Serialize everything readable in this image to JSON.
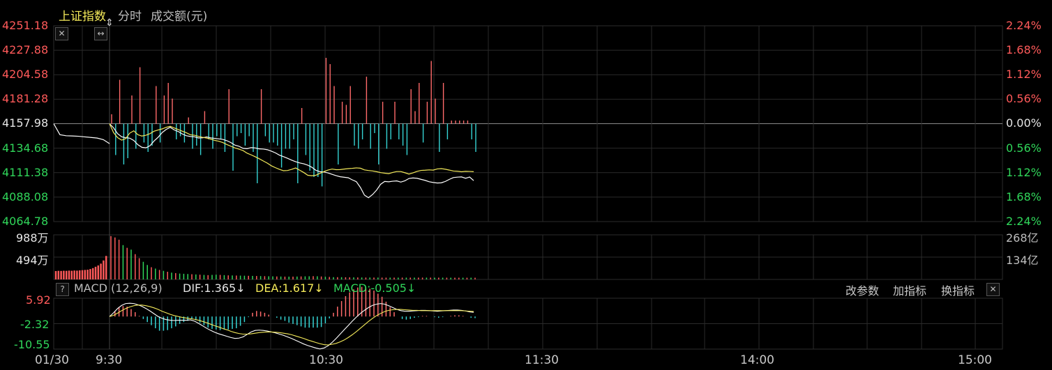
{
  "header": {
    "index_name": "上证指数",
    "mode_label": "分时",
    "volume_unit_label": "成交额(元)"
  },
  "icons": {
    "close_icon": "close-icon",
    "resize_icon": "horizontal-resize-icon",
    "help_icon": "help-icon"
  },
  "colors": {
    "up": "#ff5a5a",
    "down": "#30d65a",
    "price_line": "#ffffff",
    "avg_line": "#f4ea5a",
    "pos_bar": "#ff6a6a",
    "neg_bar": "#35d4d4",
    "grid": "#2a2a2a",
    "neutral": "#bdbdbd"
  },
  "price_axis": {
    "left_labels": [
      "4251.18",
      "4227.88",
      "4204.58",
      "4181.28",
      "4157.98",
      "4134.68",
      "4111.38",
      "4088.08",
      "4064.78"
    ],
    "right_labels": [
      "2.24%",
      "1.68%",
      "1.12%",
      "0.56%",
      "0.00%",
      "0.56%",
      "1.12%",
      "1.68%",
      "2.24%"
    ]
  },
  "volume_axis": {
    "left_labels": [
      "988万",
      "494万"
    ],
    "right_labels": [
      "268亿",
      "134亿"
    ]
  },
  "macd_panel": {
    "title": "MACD (12,26,9)",
    "dif": "DIF:1.365↓",
    "dea": "DEA:1.617↓",
    "macd": "MACD:-0.505↓",
    "axis_labels": [
      "5.92",
      "-2.32",
      "-10.55"
    ],
    "tools": [
      "改参数",
      "加指标",
      "换指标"
    ]
  },
  "time_axis": {
    "labels": [
      "01/30",
      "9:30",
      "10:30",
      "11:30",
      "14:00",
      "15:00"
    ]
  },
  "chart_data": {
    "type": "line",
    "prev_close": 4157.98,
    "ylim": [
      4064.78,
      4251.18
    ],
    "pct_range": [
      -2.24,
      2.24
    ],
    "volume_ylim": [
      0,
      988
    ],
    "macd_ylim": [
      -10.55,
      5.92
    ],
    "x_start_label": "9:30",
    "x_ticks": [
      "9:30",
      "10:30",
      "11:30",
      "14:00",
      "15:00"
    ],
    "series": [
      {
        "key": "price",
        "values": [
          4157.98,
          4154.0,
          4148.5,
          4145.5,
          4144.6,
          4144.2,
          4142.0,
          4138.0,
          4135.5,
          4135.0,
          4137.0,
          4141.5,
          4145.0,
          4149.5,
          4152.5,
          4154.5,
          4152.0,
          4150.5,
          4148.2,
          4146.5,
          4145.8,
          4145.5,
          4144.4,
          4144.5,
          4145.4,
          4144.5,
          4144.0,
          4143.5,
          4143.0,
          4141.8,
          4140.0,
          4137.5,
          4136.5,
          4134.5,
          4134.2,
          4135.2,
          4134.9,
          4134.0,
          4133.8,
          4133.2,
          4131.8,
          4130.2,
          4128.0,
          4126.6,
          4125.0,
          4123.3,
          4121.8,
          4120.6,
          4119.8,
          4118.5,
          4116.5,
          4113.6,
          4112.3,
          4112.0,
          4111.1,
          4109.8,
          4108.5,
          4107.5,
          4107.0,
          4106.5,
          4104.5,
          4102.8,
          4097.3,
          4090.0,
          4087.5,
          4090.5,
          4094.7,
          4100.3,
          4103.0,
          4102.7,
          4103.2,
          4103.5,
          4102.4,
          4103.6,
          4105.8,
          4106.3,
          4106.0,
          4105.0,
          4104.0,
          4102.7,
          4102.0,
          4101.5,
          4101.7,
          4103.0,
          4105.0,
          4106.7,
          4107.1,
          4107.3,
          4106.0,
          4107.2,
          4103.8
        ]
      },
      {
        "key": "avg_price",
        "values": [
          4157.98,
          4149.5,
          4144.7,
          4142.3,
          4143.8,
          4149.0,
          4151.2,
          4147.5,
          4146.2,
          4147.0,
          4148.5,
          4150.8,
          4152.0,
          4153.0,
          4154.5,
          4155.5,
          4153.9,
          4152.4,
          4150.8,
          4149.3,
          4147.4,
          4147.0,
          4145.9,
          4145.0,
          4144.3,
          4143.3,
          4142.1,
          4141.3,
          4140.0,
          4138.1,
          4136.5,
          4134.9,
          4133.7,
          4132.4,
          4129.9,
          4128.3,
          4126.5,
          4124.6,
          4122.5,
          4120.4,
          4117.9,
          4116.1,
          4114.5,
          4113.2,
          4113.4,
          4114.5,
          4115.8,
          4113.7,
          4111.5,
          4108.9,
          4108.4,
          4108.9,
          4110.7,
          4112.4,
          4113.8,
          4114.8,
          4114.2,
          4114.3,
          4114.8,
          4115.2,
          4115.5,
          4115.9,
          4115.6,
          4114.0,
          4113.4,
          4113.0,
          4112.3,
          4111.4,
          4110.9,
          4110.4,
          4111.6,
          4112.4,
          4112.4,
          4111.3,
          4110.0,
          4111.2,
          4112.6,
          4113.5,
          4113.7,
          4114.0,
          4113.8,
          4114.9,
          4115.2,
          4114.6,
          4113.8,
          4112.9,
          4112.7,
          4112.2,
          4112.6,
          4112.5,
          4112.3
        ]
      }
    ],
    "pre_market_price": [
      4157.98,
      4147.5,
      4146.5,
      4146.3,
      4146.0,
      4145.4,
      4144.9,
      4144.3,
      4142.8,
      4139.0
    ],
    "volume": [
      960,
      930,
      880,
      760,
      700,
      660,
      560,
      470,
      390,
      320,
      270,
      240,
      210,
      190,
      170,
      150,
      140,
      130,
      125,
      120,
      115,
      110,
      105,
      100,
      95,
      100,
      105,
      100,
      95,
      90,
      88,
      86,
      84,
      82,
      80,
      78,
      76,
      74,
      72,
      70,
      68,
      66,
      64,
      62,
      62,
      62,
      64,
      66,
      68,
      70,
      72,
      70,
      65,
      60,
      55,
      50,
      50,
      50,
      48,
      46,
      45,
      44,
      43,
      42,
      42,
      41,
      41,
      40,
      40,
      40,
      40,
      40,
      40,
      40,
      40,
      40,
      40,
      40,
      40,
      40,
      39,
      39,
      39,
      39,
      38,
      38,
      38,
      38,
      38,
      38,
      38
    ],
    "volume_up": [
      true,
      true,
      true,
      false,
      true,
      false,
      true,
      true,
      false,
      false,
      true,
      false,
      true,
      false,
      true,
      false,
      true,
      false,
      false,
      false,
      true,
      false,
      true,
      false,
      true,
      false,
      false,
      true,
      false,
      true,
      false,
      true,
      false,
      false,
      true,
      false,
      true,
      false,
      true,
      false,
      false,
      true,
      false,
      true,
      false,
      true,
      false,
      true,
      false,
      false,
      true,
      false,
      true,
      false,
      true,
      false,
      true,
      false,
      true,
      true,
      false,
      true,
      false,
      true,
      false,
      true,
      false,
      true,
      true,
      false,
      true,
      false,
      true,
      false,
      true,
      false,
      true,
      true,
      false,
      true,
      false,
      true,
      false,
      true,
      false,
      true,
      true,
      false,
      true,
      false,
      true
    ],
    "pre_market_volume": [
      185,
      190,
      188,
      192,
      190,
      195,
      192,
      198,
      195,
      200,
      205,
      210,
      215,
      230,
      250,
      280,
      310,
      350,
      420,
      520
    ],
    "breadth_bars": [
      0.3,
      -1.0,
      1.4,
      -1.3,
      -1.1,
      0.9,
      -0.8,
      1.8,
      -0.6,
      -0.9,
      -0.7,
      1.2,
      -0.6,
      0.9,
      1.3,
      0.8,
      -0.5,
      -0.4,
      -0.6,
      0.2,
      -0.8,
      -0.7,
      -1.0,
      0.4,
      -0.5,
      -0.8,
      -0.4,
      -0.5,
      -0.9,
      1.1,
      -1.5,
      -0.4,
      -0.3,
      -0.7,
      -0.4,
      -0.9,
      -1.9,
      1.1,
      -0.4,
      -0.6,
      -0.6,
      -0.7,
      -1.4,
      -0.8,
      -0.8,
      -0.5,
      -1.9,
      0.5,
      -1.0,
      -1.5,
      -1.7,
      -1.7,
      -2.0,
      2.1,
      1.9,
      1.2,
      -1.3,
      0.7,
      0.6,
      1.2,
      -0.7,
      -0.8,
      -0.5,
      1.5,
      -0.8,
      -0.3,
      -1.3,
      0.7,
      -0.8,
      -0.5,
      0.7,
      -0.5,
      -0.7,
      -1.0,
      1.1,
      0.4,
      1.3,
      -0.6,
      0.7,
      2.0,
      0.8,
      -0.9,
      1.3,
      -0.5,
      0.1,
      0.1,
      0.1,
      0.1,
      0.1,
      -0.5,
      -0.9
    ],
    "macd": {
      "dif": [
        0.0,
        1.2,
        2.6,
        3.6,
        4.2,
        4.3,
        4.2,
        3.8,
        3.3,
        2.6,
        1.8,
        0.9,
        0.0,
        -0.6,
        -1.0,
        -1.2,
        -1.3,
        -1.2,
        -1.2,
        -1.2,
        -1.1,
        -1.5,
        -2.2,
        -3.0,
        -3.8,
        -4.5,
        -5.1,
        -5.6,
        -6.0,
        -6.4,
        -6.8,
        -7.1,
        -7.0,
        -6.6,
        -5.8,
        -5.0,
        -4.5,
        -4.4,
        -4.5,
        -4.7,
        -5.0,
        -5.3,
        -5.7,
        -6.1,
        -6.6,
        -7.1,
        -7.7,
        -8.3,
        -8.9,
        -9.4,
        -9.8,
        -10.2,
        -10.5,
        -10.2,
        -9.5,
        -8.4,
        -7.1,
        -5.7,
        -4.3,
        -2.9,
        -1.5,
        -0.2,
        1.0,
        2.0,
        2.9,
        3.6,
        4.0,
        4.2,
        4.0,
        3.5,
        2.9,
        2.3,
        1.9,
        1.7,
        1.7,
        1.8,
        1.9,
        2.0,
        2.0,
        1.9,
        1.8,
        1.7,
        1.8,
        1.9,
        2.0,
        2.1,
        2.1,
        2.0,
        1.8,
        1.5,
        1.365
      ],
      "dea": [
        0.0,
        0.4,
        1.1,
        1.9,
        2.6,
        3.1,
        3.5,
        3.7,
        3.7,
        3.5,
        3.2,
        2.8,
        2.3,
        1.7,
        1.2,
        0.7,
        0.3,
        0.0,
        -0.3,
        -0.5,
        -0.7,
        -0.9,
        -1.2,
        -1.6,
        -2.0,
        -2.5,
        -3.0,
        -3.4,
        -3.9,
        -4.3,
        -4.8,
        -5.2,
        -5.5,
        -5.7,
        -5.7,
        -5.6,
        -5.4,
        -5.2,
        -5.1,
        -5.0,
        -5.0,
        -5.1,
        -5.2,
        -5.4,
        -5.6,
        -5.9,
        -6.3,
        -6.7,
        -7.1,
        -7.6,
        -8.0,
        -8.4,
        -8.8,
        -9.1,
        -9.2,
        -9.0,
        -8.7,
        -8.2,
        -7.6,
        -6.8,
        -5.9,
        -4.9,
        -3.8,
        -2.7,
        -1.6,
        -0.6,
        0.3,
        1.0,
        1.6,
        2.0,
        2.2,
        2.3,
        2.3,
        2.2,
        2.1,
        2.0,
        2.0,
        1.9,
        1.9,
        1.9,
        1.9,
        1.9,
        1.9,
        1.9,
        1.9,
        1.9,
        1.9,
        1.9,
        1.8,
        1.7,
        1.617
      ],
      "hist": [
        0.2,
        1.6,
        3.0,
        3.4,
        3.2,
        2.4,
        1.4,
        0.2,
        -0.8,
        -1.8,
        -2.8,
        -3.8,
        -4.6,
        -4.6,
        -4.4,
        -3.8,
        -3.2,
        -2.4,
        -1.8,
        -1.4,
        -0.8,
        -1.2,
        -2.0,
        -2.8,
        -3.6,
        -4.0,
        -4.2,
        -4.4,
        -4.2,
        -4.2,
        -4.0,
        -3.8,
        -3.0,
        -1.8,
        -0.2,
        1.2,
        1.8,
        1.6,
        1.2,
        0.6,
        0.0,
        -0.4,
        -1.0,
        -1.4,
        -2.0,
        -2.4,
        -2.8,
        -3.2,
        -3.6,
        -3.6,
        -3.6,
        -3.6,
        -3.4,
        -2.2,
        -0.6,
        1.2,
        3.2,
        5.0,
        6.6,
        7.8,
        8.8,
        9.4,
        9.6,
        9.4,
        9.0,
        8.4,
        7.4,
        6.4,
        4.8,
        3.0,
        1.4,
        0.0,
        -0.8,
        -1.0,
        -0.8,
        -0.4,
        -0.2,
        0.2,
        0.2,
        0.0,
        -0.2,
        -0.4,
        -0.2,
        0.0,
        0.2,
        0.4,
        0.4,
        0.2,
        0.0,
        -0.4,
        -0.505
      ]
    }
  }
}
